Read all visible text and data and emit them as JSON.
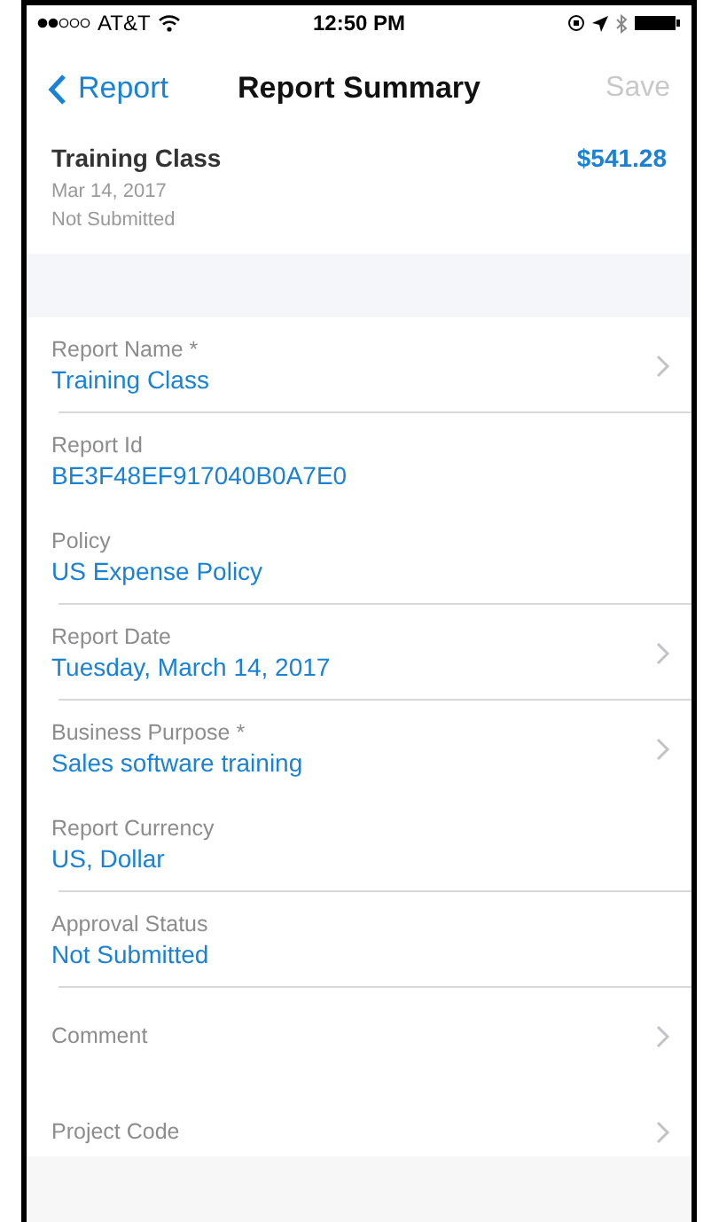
{
  "status_bar": {
    "carrier": "AT&T",
    "time": "12:50 PM"
  },
  "nav": {
    "back": "Report",
    "title": "Report Summary",
    "action": {
      "label": "Save",
      "disabled": true
    }
  },
  "summary": {
    "name": "Training Class",
    "date": "Mar 14, 2017",
    "status": "Not Submitted",
    "amount": "$541.28"
  },
  "fields": [
    {
      "label": "Report Name *",
      "value": "Training Class",
      "chevron": true,
      "divider": true
    },
    {
      "label": "Report Id",
      "value": "BE3F48EF917040B0A7E0",
      "chevron": false,
      "divider": false
    },
    {
      "label": "Policy",
      "value": "US Expense Policy",
      "chevron": false,
      "divider": true
    },
    {
      "label": "Report Date",
      "value": "Tuesday, March 14, 2017",
      "chevron": true,
      "divider": true
    },
    {
      "label": "Business Purpose *",
      "value": "Sales software training",
      "chevron": true,
      "divider": false
    },
    {
      "label": "Report Currency",
      "value": "US, Dollar",
      "chevron": false,
      "divider": true
    },
    {
      "label": "Approval Status",
      "value": "Not Submitted",
      "chevron": false,
      "divider": true
    },
    {
      "label": "Comment",
      "chevron": true,
      "divider": false
    },
    {
      "label": "Project Code",
      "chevron": true,
      "divider": false
    }
  ]
}
